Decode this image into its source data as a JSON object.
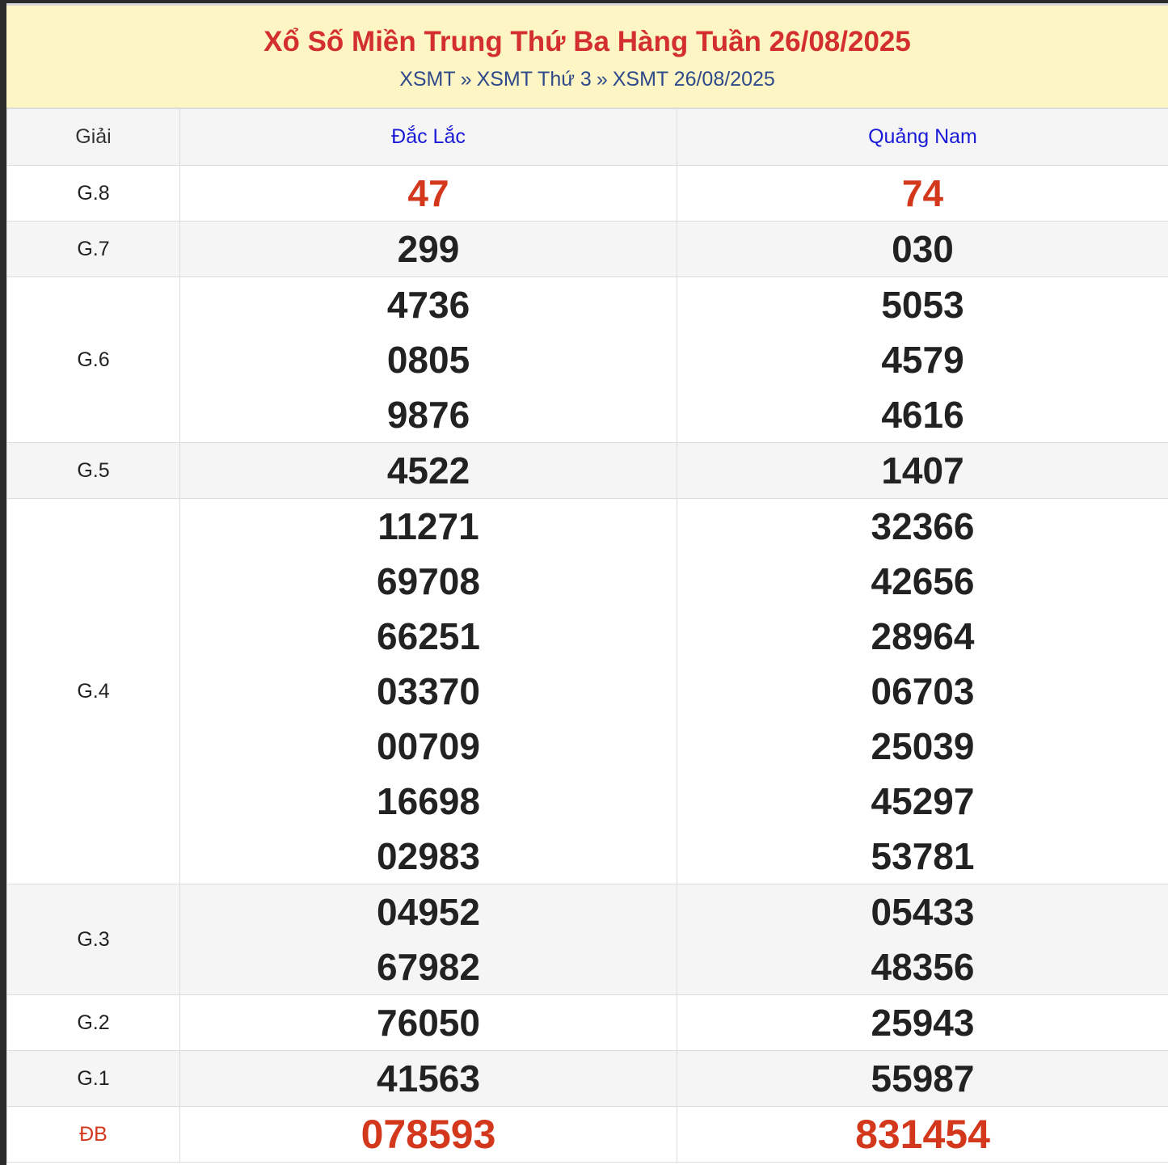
{
  "header": {
    "title": "Xổ Số Miền Trung Thứ Ba Hàng Tuần 26/08/2025",
    "breadcrumb": [
      "XSMT",
      "XSMT Thứ 3",
      "XSMT 26/08/2025"
    ],
    "separator": "»"
  },
  "table": {
    "label_header": "Giải",
    "provinces": [
      "Đắc Lắc",
      "Quảng Nam"
    ],
    "rows": [
      {
        "prize": "G.8",
        "p1": [
          "47"
        ],
        "p2": [
          "74"
        ]
      },
      {
        "prize": "G.7",
        "p1": [
          "299"
        ],
        "p2": [
          "030"
        ]
      },
      {
        "prize": "G.6",
        "p1": [
          "4736",
          "0805",
          "9876"
        ],
        "p2": [
          "5053",
          "4579",
          "4616"
        ]
      },
      {
        "prize": "G.5",
        "p1": [
          "4522"
        ],
        "p2": [
          "1407"
        ]
      },
      {
        "prize": "G.4",
        "p1": [
          "11271",
          "69708",
          "66251",
          "03370",
          "00709",
          "16698",
          "02983"
        ],
        "p2": [
          "32366",
          "42656",
          "28964",
          "06703",
          "25039",
          "45297",
          "53781"
        ]
      },
      {
        "prize": "G.3",
        "p1": [
          "04952",
          "67982"
        ],
        "p2": [
          "05433",
          "48356"
        ]
      },
      {
        "prize": "G.2",
        "p1": [
          "76050"
        ],
        "p2": [
          "25943"
        ]
      },
      {
        "prize": "G.1",
        "p1": [
          "41563"
        ],
        "p2": [
          "55987"
        ]
      },
      {
        "prize": "ĐB",
        "p1": [
          "078593"
        ],
        "p2": [
          "831454"
        ]
      }
    ]
  },
  "colors": {
    "title": "#d32f2f",
    "breadcrumb": "#2f4a8a",
    "province": "#1a1ad6",
    "highlight_number": "#d4381c",
    "header_bg": "#fdf5c4",
    "alt_row_bg": "#f5f5f5"
  }
}
